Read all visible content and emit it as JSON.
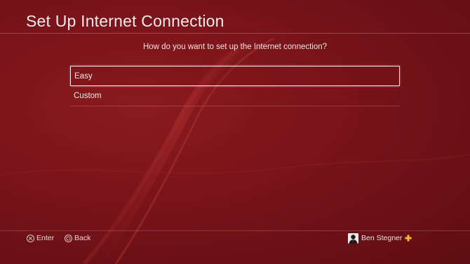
{
  "header": {
    "title": "Set Up Internet Connection"
  },
  "main": {
    "prompt": "How do you want to set up the Internet connection?",
    "options": [
      {
        "label": "Easy",
        "selected": true
      },
      {
        "label": "Custom",
        "selected": false
      }
    ]
  },
  "footer": {
    "enter_label": "Enter",
    "enter_icon": "cross-button-icon",
    "back_label": "Back",
    "back_icon": "circle-button-icon",
    "user_name": "Ben Stegner",
    "plus_icon": "playstation-plus-icon"
  },
  "colors": {
    "background": "#7a141a",
    "plus": "#f2b640",
    "text": "#f0e6e6"
  }
}
